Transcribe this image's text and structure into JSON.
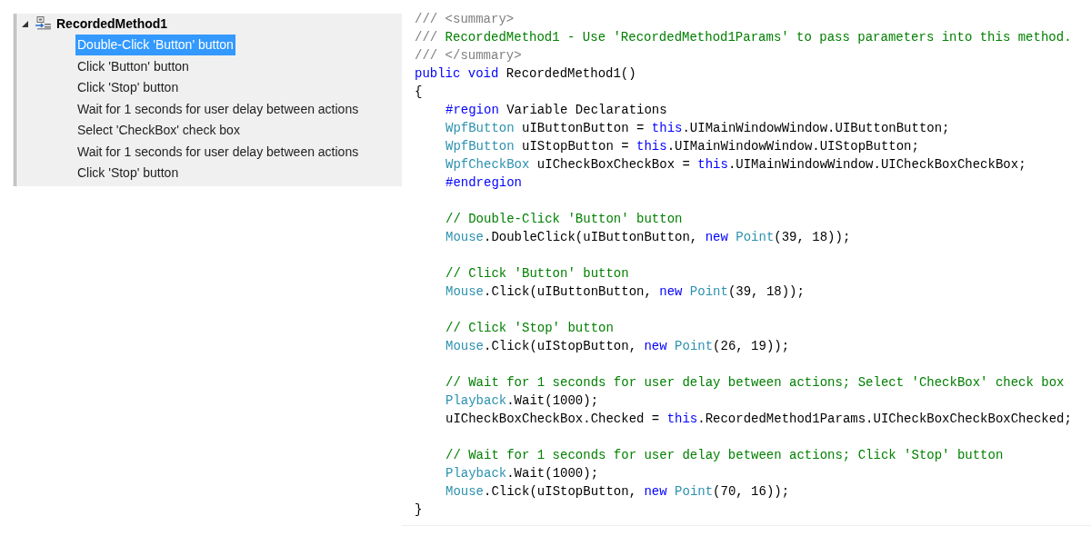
{
  "tree": {
    "title": "RecordedMethod1",
    "expanded": true,
    "items": [
      {
        "label": "Double-Click 'Button' button",
        "selected": true
      },
      {
        "label": "Click 'Button' button",
        "selected": false
      },
      {
        "label": "Click 'Stop' button",
        "selected": false
      },
      {
        "label": "Wait for 1 seconds for user delay between actions",
        "selected": false
      },
      {
        "label": "Select 'CheckBox' check box",
        "selected": false
      },
      {
        "label": "Wait for 1 seconds for user delay between actions",
        "selected": false
      },
      {
        "label": "Click 'Stop' button",
        "selected": false
      }
    ]
  },
  "code": {
    "lines": [
      {
        "kind": "code",
        "indented": false,
        "tokens": [
          {
            "kind": "doc",
            "text": "/// <summary>"
          }
        ]
      },
      {
        "kind": "code",
        "indented": false,
        "tokens": [
          {
            "kind": "doc",
            "text": "///"
          },
          {
            "kind": "comment",
            "text": " RecordedMethod1 - Use 'RecordedMethod1Params' to pass parameters into this method."
          }
        ]
      },
      {
        "kind": "code",
        "indented": false,
        "tokens": [
          {
            "kind": "doc",
            "text": "/// </summary>"
          }
        ]
      },
      {
        "kind": "code",
        "indented": false,
        "tokens": [
          {
            "kind": "keyword",
            "text": "public void"
          },
          {
            "kind": "plain",
            "text": " RecordedMethod1()"
          }
        ]
      },
      {
        "kind": "code",
        "indented": false,
        "tokens": [
          {
            "kind": "plain",
            "text": "{"
          }
        ]
      },
      {
        "kind": "code",
        "indented": true,
        "tokens": [
          {
            "kind": "keyword",
            "text": "#region"
          },
          {
            "kind": "plain",
            "text": " Variable Declarations"
          }
        ]
      },
      {
        "kind": "code",
        "indented": true,
        "tokens": [
          {
            "kind": "type",
            "text": "WpfButton"
          },
          {
            "kind": "plain",
            "text": " uIButtonButton = "
          },
          {
            "kind": "keyword",
            "text": "this"
          },
          {
            "kind": "plain",
            "text": ".UIMainWindowWindow.UIButtonButton;"
          }
        ]
      },
      {
        "kind": "code",
        "indented": true,
        "tokens": [
          {
            "kind": "type",
            "text": "WpfButton"
          },
          {
            "kind": "plain",
            "text": " uIStopButton = "
          },
          {
            "kind": "keyword",
            "text": "this"
          },
          {
            "kind": "plain",
            "text": ".UIMainWindowWindow.UIStopButton;"
          }
        ]
      },
      {
        "kind": "code",
        "indented": true,
        "tokens": [
          {
            "kind": "type",
            "text": "WpfCheckBox"
          },
          {
            "kind": "plain",
            "text": " uICheckBoxCheckBox = "
          },
          {
            "kind": "keyword",
            "text": "this"
          },
          {
            "kind": "plain",
            "text": ".UIMainWindowWindow.UICheckBoxCheckBox;"
          }
        ]
      },
      {
        "kind": "code",
        "indented": true,
        "tokens": [
          {
            "kind": "keyword",
            "text": "#endregion"
          }
        ]
      },
      {
        "kind": "blank"
      },
      {
        "kind": "code",
        "indented": true,
        "tokens": [
          {
            "kind": "comment",
            "text": "// Double-Click 'Button' button"
          }
        ]
      },
      {
        "kind": "code",
        "indented": true,
        "tokens": [
          {
            "kind": "type",
            "text": "Mouse"
          },
          {
            "kind": "plain",
            "text": ".DoubleClick(uIButtonButton, "
          },
          {
            "kind": "keyword",
            "text": "new"
          },
          {
            "kind": "type",
            "text": " Point"
          },
          {
            "kind": "plain",
            "text": "(39, 18));"
          }
        ]
      },
      {
        "kind": "blank"
      },
      {
        "kind": "code",
        "indented": true,
        "tokens": [
          {
            "kind": "comment",
            "text": "// Click 'Button' button"
          }
        ]
      },
      {
        "kind": "code",
        "indented": true,
        "tokens": [
          {
            "kind": "type",
            "text": "Mouse"
          },
          {
            "kind": "plain",
            "text": ".Click(uIButtonButton, "
          },
          {
            "kind": "keyword",
            "text": "new"
          },
          {
            "kind": "type",
            "text": " Point"
          },
          {
            "kind": "plain",
            "text": "(39, 18));"
          }
        ]
      },
      {
        "kind": "blank"
      },
      {
        "kind": "code",
        "indented": true,
        "tokens": [
          {
            "kind": "comment",
            "text": "// Click 'Stop' button"
          }
        ]
      },
      {
        "kind": "code",
        "indented": true,
        "tokens": [
          {
            "kind": "type",
            "text": "Mouse"
          },
          {
            "kind": "plain",
            "text": ".Click(uIStopButton, "
          },
          {
            "kind": "keyword",
            "text": "new"
          },
          {
            "kind": "type",
            "text": " Point"
          },
          {
            "kind": "plain",
            "text": "(26, 19));"
          }
        ]
      },
      {
        "kind": "blank"
      },
      {
        "kind": "code",
        "indented": true,
        "tokens": [
          {
            "kind": "comment",
            "text": "// Wait for 1 seconds for user delay between actions; Select 'CheckBox' check box"
          }
        ]
      },
      {
        "kind": "code",
        "indented": true,
        "tokens": [
          {
            "kind": "type",
            "text": "Playback"
          },
          {
            "kind": "plain",
            "text": ".Wait(1000);"
          }
        ]
      },
      {
        "kind": "code",
        "indented": true,
        "tokens": [
          {
            "kind": "plain",
            "text": "uICheckBoxCheckBox.Checked = "
          },
          {
            "kind": "keyword",
            "text": "this"
          },
          {
            "kind": "plain",
            "text": ".RecordedMethod1Params.UICheckBoxCheckBoxChecked;"
          }
        ]
      },
      {
        "kind": "blank"
      },
      {
        "kind": "code",
        "indented": true,
        "tokens": [
          {
            "kind": "comment",
            "text": "// Wait for 1 seconds for user delay between actions; Click 'Stop' button"
          }
        ]
      },
      {
        "kind": "code",
        "indented": true,
        "tokens": [
          {
            "kind": "type",
            "text": "Playback"
          },
          {
            "kind": "plain",
            "text": ".Wait(1000);"
          }
        ]
      },
      {
        "kind": "code",
        "indented": true,
        "tokens": [
          {
            "kind": "type",
            "text": "Mouse"
          },
          {
            "kind": "plain",
            "text": ".Click(uIStopButton, "
          },
          {
            "kind": "keyword",
            "text": "new"
          },
          {
            "kind": "type",
            "text": " Point"
          },
          {
            "kind": "plain",
            "text": "(70, 16));"
          }
        ]
      },
      {
        "kind": "code",
        "indented": false,
        "tokens": [
          {
            "kind": "plain",
            "text": "}"
          }
        ]
      }
    ]
  }
}
